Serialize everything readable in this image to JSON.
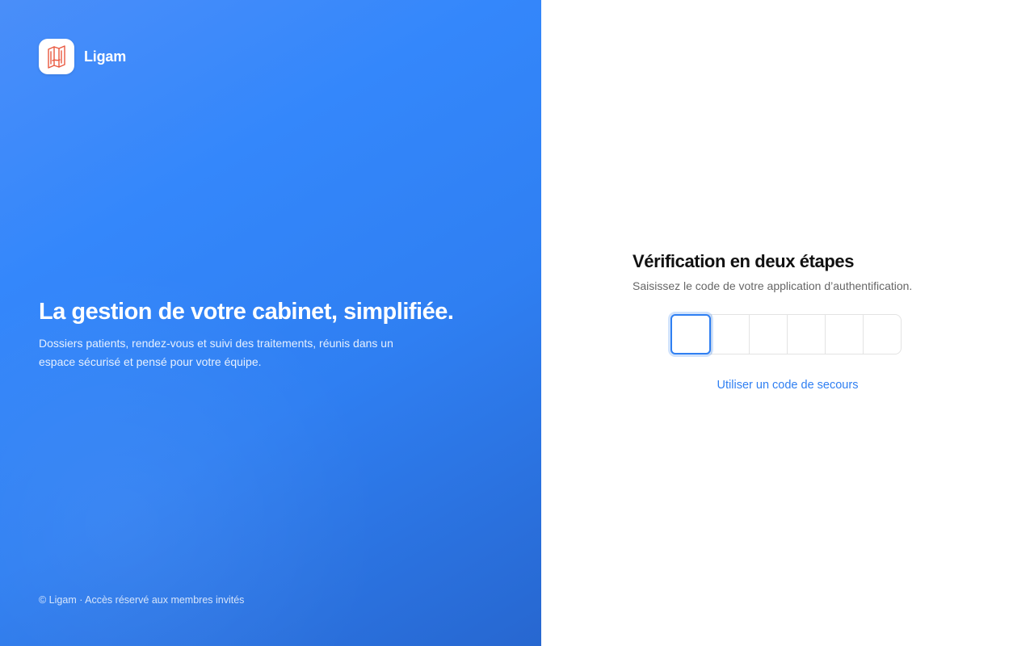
{
  "brand": {
    "name": "Ligam",
    "logo_icon": "ligam-logo-icon",
    "logo_color": "#e9583f"
  },
  "hero": {
    "title": "La gestion de votre cabinet, simplifiée.",
    "description": "Dossiers patients, rendez-vous et suivi des traitements, réunis dans un espace sécurisé et pensé pour votre équipe."
  },
  "footer": {
    "text": "© Ligam · Accès réservé aux membres invités"
  },
  "verification": {
    "title": "Vérification en deux étapes",
    "subtitle": "Saisissez le code de votre application d’authentification.",
    "code_digits": [
      "",
      "",
      "",
      "",
      "",
      ""
    ],
    "backup_link_label": "Utiliser un code de secours"
  },
  "colors": {
    "accent": "#2f7ff2",
    "panel_gradient_start": "#4a8ef9",
    "panel_gradient_end": "#2767d0",
    "text_primary": "#111111",
    "text_muted": "#666666"
  }
}
